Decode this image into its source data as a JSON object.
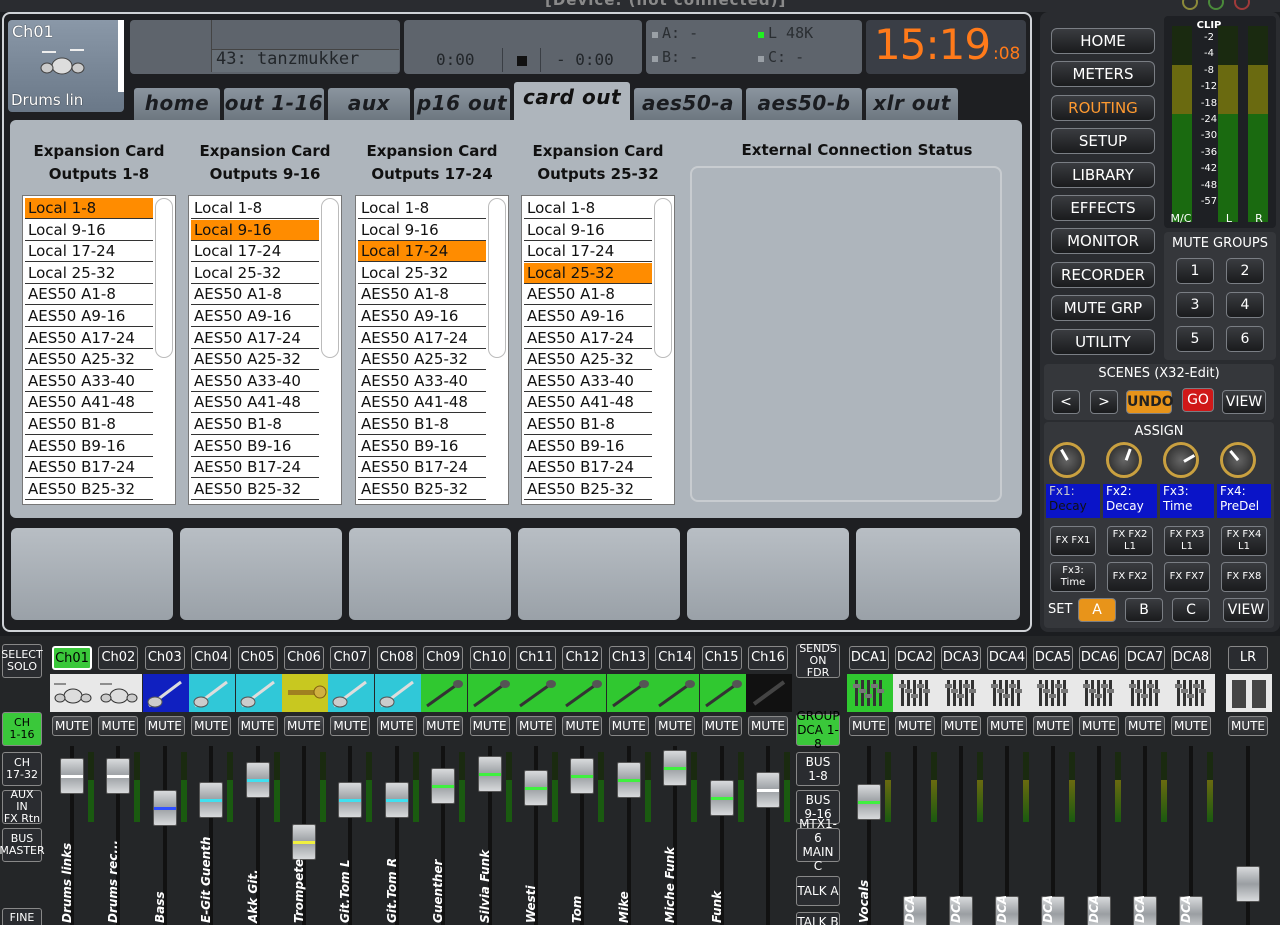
{
  "titlebar": {
    "title": "[Device: (not connected)]"
  },
  "channel": {
    "name": "Ch01",
    "label": "Drums lin"
  },
  "scene_display": {
    "scene": "43: tanzmukker"
  },
  "transport": {
    "elapsed": "0:00",
    "remaining": "- 0:00"
  },
  "sync": {
    "a": "A:  -",
    "b": "B:  -",
    "l": "L  48K",
    "c": "C:  -"
  },
  "clock": {
    "time": "15:19",
    "seconds": ":08"
  },
  "tabs": [
    "home",
    "out 1-16",
    "aux out",
    "p16 out",
    "card out",
    "aes50-a",
    "aes50-b",
    "xlr out"
  ],
  "active_tab": "card out",
  "routing": {
    "columns": [
      {
        "title": "Expansion Card",
        "subtitle": "Outputs 1-8",
        "selected": 0
      },
      {
        "title": "Expansion Card",
        "subtitle": "Outputs 9-16",
        "selected": 1
      },
      {
        "title": "Expansion Card",
        "subtitle": "Outputs 17-24",
        "selected": 2
      },
      {
        "title": "Expansion Card",
        "subtitle": "Outputs 25-32",
        "selected": 3
      }
    ],
    "options": [
      "Local 1-8",
      "Local 9-16",
      "Local 17-24",
      "Local 25-32",
      "AES50 A1-8",
      "AES50 A9-16",
      "AES50 A17-24",
      "AES50 A25-32",
      "AES50 A33-40",
      "AES50 A41-48",
      "AES50 B1-8",
      "AES50 B9-16",
      "AES50 B17-24",
      "AES50 B25-32"
    ],
    "external_title": "External Connection Status"
  },
  "nav": [
    "HOME",
    "METERS",
    "ROUTING",
    "SETUP",
    "LIBRARY",
    "EFFECTS",
    "MONITOR",
    "RECORDER",
    "MUTE GRP",
    "UTILITY"
  ],
  "nav_active": "ROUTING",
  "meters": {
    "clip": "CLIP",
    "scale": [
      "-2",
      "-4",
      "-8",
      "-12",
      "-18",
      "-24",
      "-30",
      "-36",
      "-42",
      "-48",
      "-57"
    ],
    "mc": "M/C",
    "l": "L",
    "r": "R"
  },
  "mute_groups": {
    "title": "MUTE GROUPS",
    "buttons": [
      "1",
      "2",
      "3",
      "4",
      "5",
      "6"
    ]
  },
  "scenes": {
    "title": "SCENES (X32-Edit)",
    "prev": "<",
    "next": ">",
    "undo": "UNDO",
    "go": "GO",
    "view": "VIEW"
  },
  "assign": {
    "title": "ASSIGN",
    "fx_labels": [
      [
        "Fx1:",
        "Decay"
      ],
      [
        "Fx2:",
        "Decay"
      ],
      [
        "Fx3:",
        "Time"
      ],
      [
        "Fx4:",
        "PreDel"
      ]
    ],
    "row1": [
      [
        "FX FX1",
        ""
      ],
      [
        "FX FX2",
        "L1"
      ],
      [
        "FX FX3",
        "L1"
      ],
      [
        "FX FX4",
        "L1"
      ]
    ],
    "row2": [
      [
        "Fx3:",
        "Time"
      ],
      [
        "FX FX2",
        ""
      ],
      [
        "FX FX7",
        ""
      ],
      [
        "FX FX8",
        ""
      ]
    ],
    "set": "SET",
    "sets": [
      "A",
      "B",
      "C"
    ],
    "view": "VIEW"
  },
  "left_controls": {
    "select_solo": [
      "SELECT",
      "SOLO"
    ],
    "ch_1_16": [
      "CH",
      "1-16"
    ],
    "ch_17_32": [
      "CH",
      "17-32"
    ],
    "aux": [
      "AUX IN",
      "FX Rtn"
    ],
    "bus": [
      "BUS",
      "MASTER"
    ],
    "fine": "FINE"
  },
  "channels": [
    {
      "tag": "Ch01",
      "name": "Drums links",
      "color": "#e8e8e8",
      "line": "#ffffff"
    },
    {
      "tag": "Ch02",
      "name": "Drums rec...",
      "color": "#e8e8e8",
      "line": "#ffffff"
    },
    {
      "tag": "Ch03",
      "name": "Bass",
      "color": "#1020c0",
      "line": "#3050ff"
    },
    {
      "tag": "Ch04",
      "name": "E-Git Guenth",
      "color": "#30c8d8",
      "line": "#40e0f0"
    },
    {
      "tag": "Ch05",
      "name": "Akk Git.",
      "color": "#30c8d8",
      "line": "#40e0f0"
    },
    {
      "tag": "Ch06",
      "name": "Trompete",
      "color": "#c8c820",
      "line": "#f0f040"
    },
    {
      "tag": "Ch07",
      "name": "Git.Tom L",
      "color": "#30c8d8",
      "line": "#40e0f0"
    },
    {
      "tag": "Ch08",
      "name": "Git.Tom R",
      "color": "#30c8d8",
      "line": "#40e0f0"
    },
    {
      "tag": "Ch09",
      "name": "Guenther",
      "color": "#30c830",
      "line": "#40f040"
    },
    {
      "tag": "Ch10",
      "name": "Silvia Funk",
      "color": "#30c830",
      "line": "#40f040"
    },
    {
      "tag": "Ch11",
      "name": "Westi",
      "color": "#30c830",
      "line": "#40f040"
    },
    {
      "tag": "Ch12",
      "name": "Tom",
      "color": "#30c830",
      "line": "#40f040"
    },
    {
      "tag": "Ch13",
      "name": "Mike",
      "color": "#30c830",
      "line": "#40f040"
    },
    {
      "tag": "Ch14",
      "name": "Miche Funk",
      "color": "#30c830",
      "line": "#40f040"
    },
    {
      "tag": "Ch15",
      "name": "Funk",
      "color": "#30c830",
      "line": "#40f040"
    },
    {
      "tag": "Ch16",
      "name": "",
      "color": "#111111",
      "line": "#ffffff"
    }
  ],
  "sends_on_fdr": [
    "SENDS",
    "ON FDR"
  ],
  "mid_controls": {
    "group": [
      "GROUP",
      "DCA 1-8"
    ],
    "bus_1_8": [
      "BUS",
      "1-8"
    ],
    "bus_9_16": [
      "BUS",
      "9-16"
    ],
    "mtx": [
      "MTX1-6",
      "MAIN C"
    ],
    "talk_a": "TALK A",
    "talk_b": "TALK B"
  },
  "dcas": [
    {
      "tag": "DCA1",
      "name": "Vocals"
    },
    {
      "tag": "DCA2",
      "name": "DCA"
    },
    {
      "tag": "DCA3",
      "name": "DCA"
    },
    {
      "tag": "DCA4",
      "name": "DCA"
    },
    {
      "tag": "DCA5",
      "name": "DCA"
    },
    {
      "tag": "DCA6",
      "name": "DCA"
    },
    {
      "tag": "DCA7",
      "name": "DCA"
    },
    {
      "tag": "DCA8",
      "name": "DCA"
    }
  ],
  "lr": {
    "tag": "LR"
  },
  "mute_label": "MUTE"
}
